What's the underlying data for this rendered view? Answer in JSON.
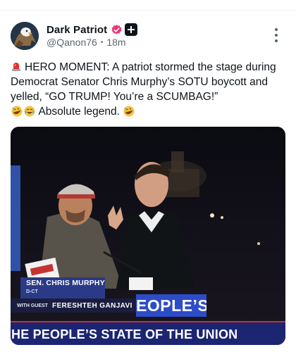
{
  "post": {
    "display_name": "Dark Patriot",
    "handle": "@Qanon76",
    "separator": "•",
    "time": "18m",
    "text_main": "HERO MOMENT: A patriot stormed the stage during Democrat Senator Chris Murphy’s SOTU boycott and yelled, “GO TRUMP! You’re a SCUMBAG!”",
    "text_tail": "Absolute legend."
  },
  "video": {
    "lower_third_name": "SEN. CHRIS MURPHY",
    "lower_third_party": "D-CT",
    "guest_prefix": "WITH GUEST",
    "guest_name": "FERESHTEH GANJAVI",
    "podium_text": "EOPLE’S",
    "banner_text": "HE PEOPLE’S STATE OF THE UNION"
  },
  "icons": {
    "avatar": "eagle-avatar-icon",
    "verified": "verified-badge-icon",
    "plus": "plus-badge-icon",
    "more": "more-options-icon",
    "siren": "siren-emoji-icon",
    "laugh": "rolling-laughing-emoji-icon",
    "joy": "tears-of-joy-emoji-icon"
  },
  "colors": {
    "verified": "#e6397b",
    "banner": "#1b2571",
    "lower_third": "#2a3a86"
  }
}
